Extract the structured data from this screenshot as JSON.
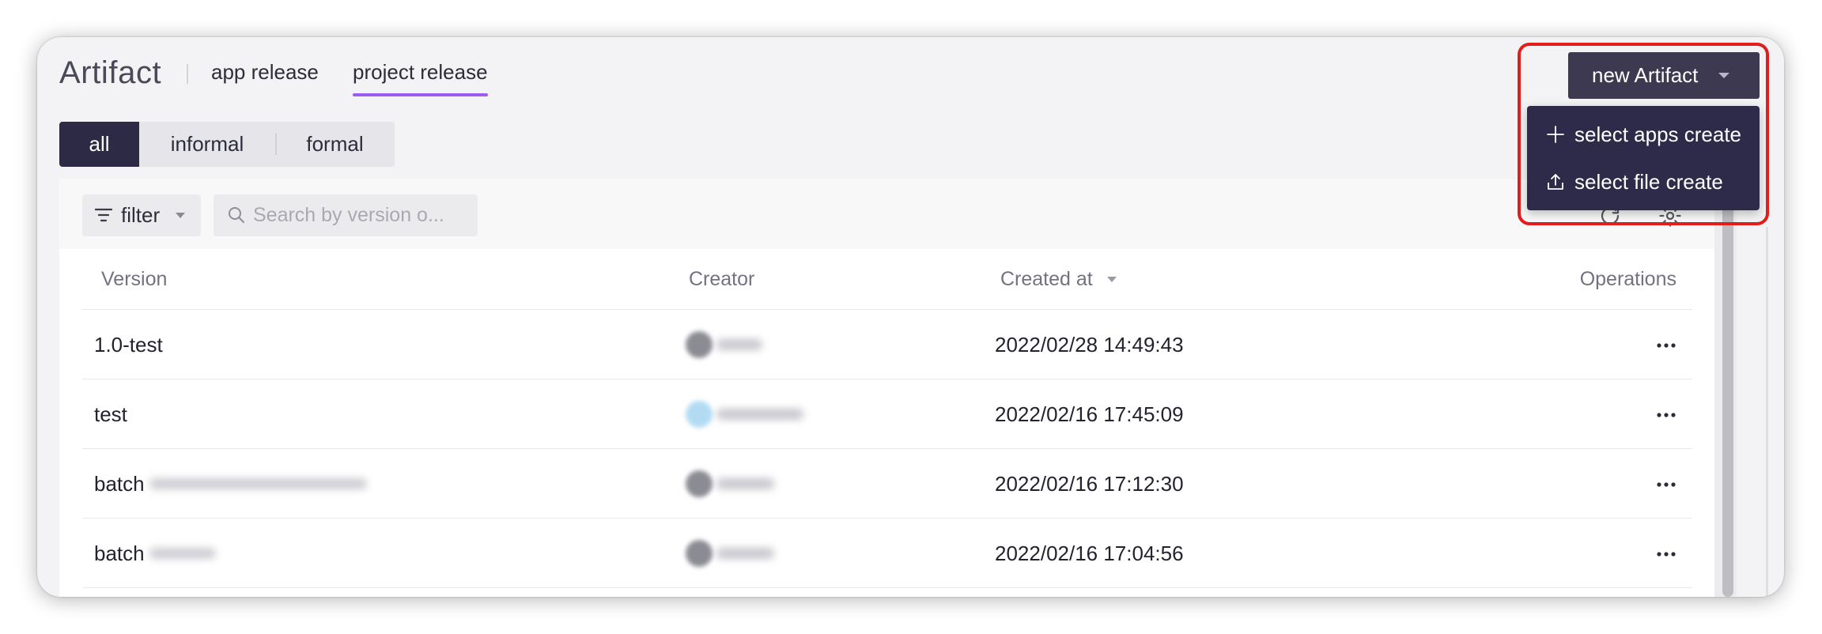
{
  "colors": {
    "accent": "#9b5cf0",
    "dark": "#2d2a46",
    "button": "#3c3951",
    "menu": "#2e2a4a",
    "highlight": "#e11d1d"
  },
  "header": {
    "title": "Artifact",
    "tabs": [
      {
        "label": "app release",
        "active": false
      },
      {
        "label": "project release",
        "active": true
      }
    ]
  },
  "segments": [
    {
      "label": "all",
      "active": true
    },
    {
      "label": "informal",
      "active": false
    },
    {
      "label": "formal",
      "active": false
    }
  ],
  "toolbar": {
    "filter": {
      "label": "filter",
      "icon": "filter-icon",
      "caret_icon": "caret-down-icon"
    },
    "search": {
      "placeholder": "Search by version o...",
      "icon": "search-icon"
    },
    "actions": [
      {
        "icon": "refresh-icon"
      },
      {
        "icon": "settings-icon"
      }
    ]
  },
  "table": {
    "columns": {
      "version": "Version",
      "creator": "Creator",
      "created_at": "Created at",
      "operations": "Operations"
    },
    "sort_icon": "caret-down-icon",
    "rows": [
      {
        "version": "1.0-test",
        "created_at": "2022/02/28 14:49:43",
        "operations_icon": "more-icon"
      },
      {
        "version": "test",
        "created_at": "2022/02/16 17:45:09",
        "operations_icon": "more-icon"
      },
      {
        "version": "batch",
        "created_at": "2022/02/16 17:12:30",
        "operations_icon": "more-icon"
      },
      {
        "version": "batch",
        "created_at": "2022/02/16 17:04:56",
        "operations_icon": "more-icon"
      }
    ]
  },
  "new_artifact": {
    "label": "new Artifact",
    "caret_icon": "caret-down-icon",
    "menu": [
      {
        "label": "select apps create",
        "icon": "plus-icon"
      },
      {
        "label": "select file create",
        "icon": "upload-icon"
      }
    ]
  }
}
